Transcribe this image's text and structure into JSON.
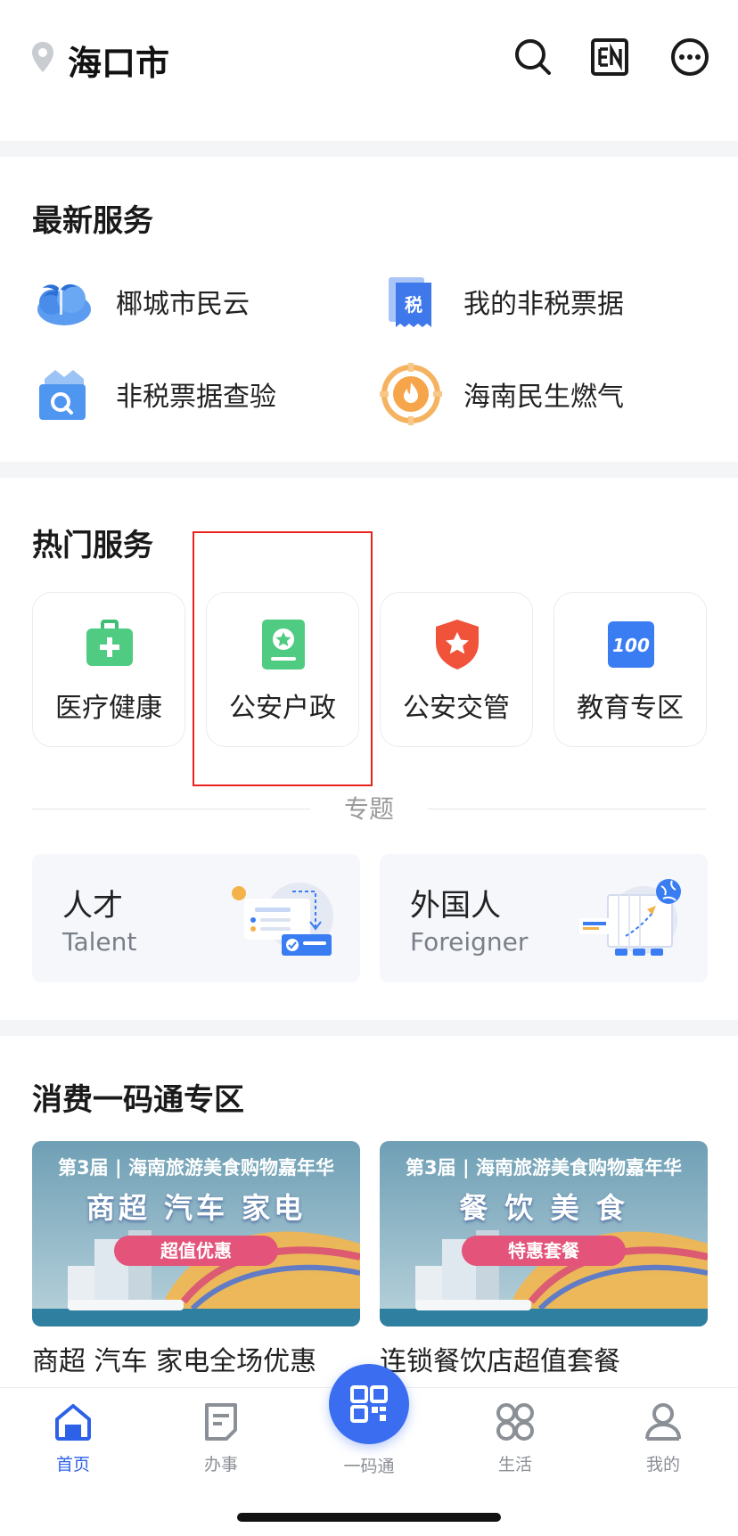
{
  "header": {
    "city": "海口市",
    "icons": [
      "location-pin-icon",
      "search-icon",
      "en-language-icon",
      "more-icon"
    ]
  },
  "latest_services": {
    "title": "最新服务",
    "items": [
      {
        "label": "椰城市民云",
        "icon": "coconut-city-cloud-icon"
      },
      {
        "label": "我的非税票据",
        "icon": "tax-receipt-icon"
      },
      {
        "label": "非税票据查验",
        "icon": "receipt-search-icon"
      },
      {
        "label": "海南民生燃气",
        "icon": "gas-flame-icon"
      }
    ]
  },
  "hot_services": {
    "title": "热门服务",
    "items": [
      {
        "label": "医疗健康",
        "icon": "medical-kit-icon",
        "color": "#3dbf72"
      },
      {
        "label": "公安户政",
        "icon": "police-household-icon",
        "color": "#3dbf72"
      },
      {
        "label": "公安交管",
        "icon": "police-shield-icon",
        "color": "#f0523a"
      },
      {
        "label": "教育专区",
        "icon": "education-100-icon",
        "color": "#3a7df3"
      }
    ]
  },
  "topics": {
    "label": "专题",
    "items": [
      {
        "title": "人才",
        "subtitle": "Talent",
        "icon": "talent-illustration-icon"
      },
      {
        "title": "外国人",
        "subtitle": "Foreigner",
        "icon": "foreigner-illustration-icon"
      }
    ]
  },
  "consumption": {
    "title": "消费一码通专区",
    "promos": [
      {
        "banner_line1": "第3届 | 海南旅游美食购物嘉年华",
        "banner_line2": "商超 汽车 家电",
        "banner_pill": "超值优惠",
        "caption": "商超 汽车 家电全场优惠"
      },
      {
        "banner_line1": "第3届 | 海南旅游美食购物嘉年华",
        "banner_line2": "餐 饮 美 食",
        "banner_pill": "特惠套餐",
        "caption": "连锁餐饮店超值套餐"
      }
    ]
  },
  "tabbar": {
    "tabs": [
      {
        "label": "首页",
        "icon": "home-icon",
        "active": true
      },
      {
        "label": "办事",
        "icon": "document-icon",
        "active": false
      },
      {
        "label": "一码通",
        "icon": "qr-code-icon",
        "active": false
      },
      {
        "label": "生活",
        "icon": "grid-apps-icon",
        "active": false
      },
      {
        "label": "我的",
        "icon": "user-icon",
        "active": false
      }
    ]
  },
  "colors": {
    "accent": "#2d62e8",
    "highlight_border": "#e8231f",
    "section_gap": "#f4f5f7"
  }
}
